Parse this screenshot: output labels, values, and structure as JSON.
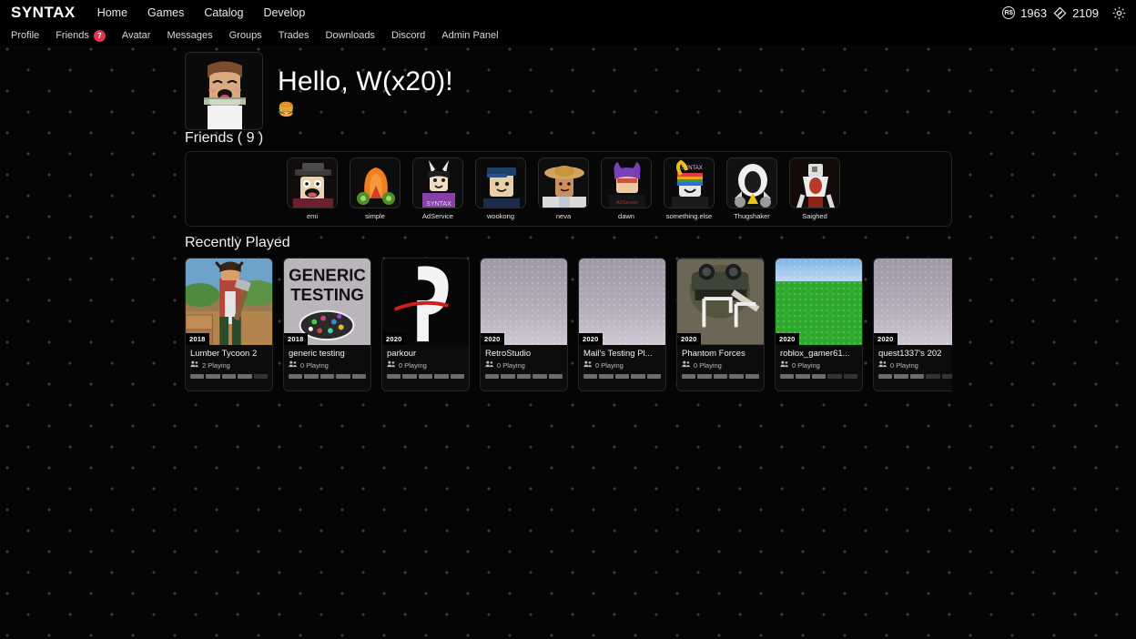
{
  "header": {
    "brand": "SYNTAX",
    "main_nav": [
      "Home",
      "Games",
      "Catalog",
      "Develop"
    ],
    "sub_nav": [
      {
        "label": "Profile",
        "badge": null
      },
      {
        "label": "Friends",
        "badge": "7"
      },
      {
        "label": "Avatar",
        "badge": null
      },
      {
        "label": "Messages",
        "badge": null
      },
      {
        "label": "Groups",
        "badge": null
      },
      {
        "label": "Trades",
        "badge": null
      },
      {
        "label": "Downloads",
        "badge": null
      },
      {
        "label": "Discord",
        "badge": null
      },
      {
        "label": "Admin Panel",
        "badge": null
      }
    ],
    "currency": {
      "robux_icon": "robux-icon",
      "robux_symbol": "R$",
      "robux_amount": "1963",
      "tix_icon": "tix-icon",
      "tix_amount": "2109",
      "settings_icon": "gear-icon"
    }
  },
  "hero": {
    "avatar_name": "user-avatar",
    "greeting": "Hello, W(x20)!",
    "status_emoji": "🍔"
  },
  "friends": {
    "title": "Friends ( 9 )",
    "items": [
      {
        "name": "emi"
      },
      {
        "name": "simple"
      },
      {
        "name": "AdService"
      },
      {
        "name": "wookong"
      },
      {
        "name": "neva"
      },
      {
        "name": "dawn"
      },
      {
        "name": "something.else"
      },
      {
        "name": "Thugshaker"
      },
      {
        "name": "Saighed"
      }
    ]
  },
  "recently_played": {
    "title": "Recently Played",
    "games": [
      {
        "title": "Lumber Tycoon 2",
        "year": "2018",
        "playing": "2 Playing",
        "art": "lumber",
        "rating_filled": 4,
        "rating_total": 5
      },
      {
        "title": "generic testing",
        "year": "2018",
        "playing": "0 Playing",
        "art": "generic",
        "rating_filled": 5,
        "rating_total": 5
      },
      {
        "title": "parkour",
        "year": "2020",
        "playing": "0 Playing",
        "art": "parkour",
        "rating_filled": 5,
        "rating_total": 5
      },
      {
        "title": "RetroStudio",
        "year": "2020",
        "playing": "0 Playing",
        "art": "baseplate",
        "rating_filled": 5,
        "rating_total": 5
      },
      {
        "title": "Mail's Testing Pl...",
        "year": "2020",
        "playing": "0 Playing",
        "art": "baseplate",
        "rating_filled": 5,
        "rating_total": 5
      },
      {
        "title": "Phantom Forces",
        "year": "2020",
        "playing": "0 Playing",
        "art": "phantom",
        "rating_filled": 5,
        "rating_total": 5
      },
      {
        "title": "roblox_gamer61...",
        "year": "2020",
        "playing": "0 Playing",
        "art": "baseplate-green",
        "rating_filled": 3,
        "rating_total": 5
      },
      {
        "title": "quest1337's 202",
        "year": "2020",
        "playing": "0 Playing",
        "art": "baseplate",
        "rating_filled": 3,
        "rating_total": 5
      }
    ],
    "playing_icon": "people-icon"
  },
  "colors": {
    "background": "#050505",
    "dot": "#3c3c3c",
    "header": "#000000",
    "badge_red": "#e0364f",
    "text": "#ffffff"
  }
}
